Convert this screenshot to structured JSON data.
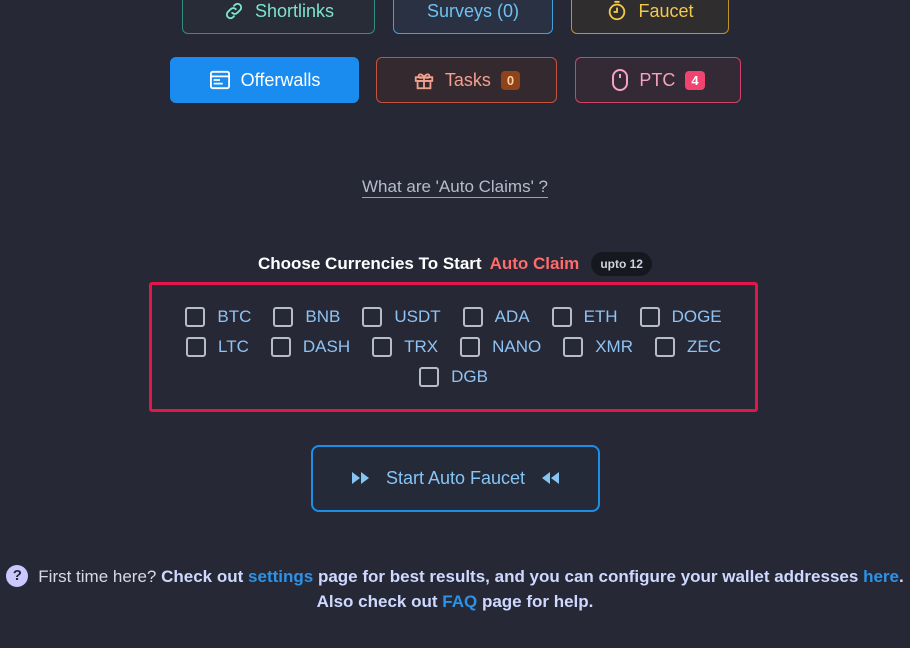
{
  "top_buttons": {
    "shortlinks": "Shortlinks",
    "surveys": "Surveys (0)",
    "faucet": "Faucet",
    "offerwalls": "Offerwalls",
    "tasks": "Tasks",
    "tasks_count": "0",
    "ptc": "PTC",
    "ptc_count": "4"
  },
  "icons": {
    "shortlinks": "link-icon",
    "faucet": "timer-icon",
    "offerwalls": "browser-window-icon",
    "tasks": "gift-icon",
    "ptc": "mouse-icon",
    "start_left": "fast-forward-icon",
    "start_right": "rewind-icon",
    "help": "question-icon"
  },
  "what_link": "What are 'Auto Claims' ?",
  "choose": {
    "prefix": "Choose Currencies To Start",
    "accent": "Auto Claim",
    "upto": "upto 12"
  },
  "currencies": {
    "row1": [
      "BTC",
      "BNB",
      "USDT",
      "ADA",
      "ETH",
      "DOGE"
    ],
    "row2": [
      "LTC",
      "DASH",
      "TRX",
      "NANO",
      "XMR",
      "ZEC"
    ],
    "row3": [
      "DGB"
    ]
  },
  "start_button": "Start Auto Faucet",
  "footer": {
    "q": "?",
    "part1": "First time here?",
    "part2": "Check out",
    "settings": "settings",
    "part3": "page for best results, and you can configure your wallet addresses",
    "here": "here",
    "part4": ". Also check out",
    "faq": "FAQ",
    "part5": "page for help."
  },
  "colors": {
    "background": "#262836",
    "highlight_border": "#e3154a",
    "accent_red": "#ff6b6b",
    "link_blue": "#2a93ea"
  }
}
